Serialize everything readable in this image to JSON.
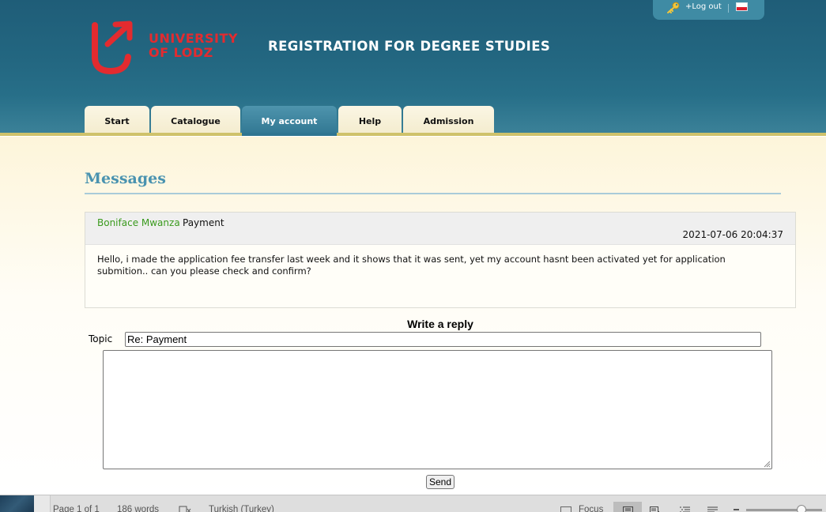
{
  "header": {
    "logo_line1": "UNIVERSITY",
    "logo_line2": "OF LODZ",
    "site_title": "REGISTRATION FOR DEGREE STUDIES",
    "logout_label": "+Log out",
    "language_flag": "flag-icon",
    "key_icon": "key-icon"
  },
  "nav": {
    "tabs": [
      {
        "label": "Start",
        "active": false
      },
      {
        "label": "Catalogue",
        "active": false
      },
      {
        "label": "My account",
        "active": true
      },
      {
        "label": "Help",
        "active": false
      },
      {
        "label": "Admission",
        "active": false
      }
    ]
  },
  "page": {
    "title": "Messages"
  },
  "message": {
    "sender": "Boniface Mwanza",
    "subject": "Payment",
    "datetime": "2021-07-06 20:04:37",
    "body": "Hello, i made the application fee transfer last week and it shows that it was sent, yet my account hasnt been activated yet for application submition.. can you please check and confirm?"
  },
  "reply": {
    "title": "Write a reply",
    "topic_label": "Topic",
    "topic_value": "Re: Payment",
    "body_value": "",
    "send_label": "Send"
  },
  "status_bar": {
    "page_info": "Page 1 of 1",
    "word_count": "186 words",
    "language": "Turkish (Turkey)",
    "focus_label": "Focus"
  },
  "colors": {
    "header_bg": "#236781",
    "logo_red": "#e32b2f",
    "tab_bg": "#f3ebcc",
    "tab_active": "#2f7590",
    "title_blue": "#4a93b0",
    "sender_green": "#3a9a1d"
  }
}
